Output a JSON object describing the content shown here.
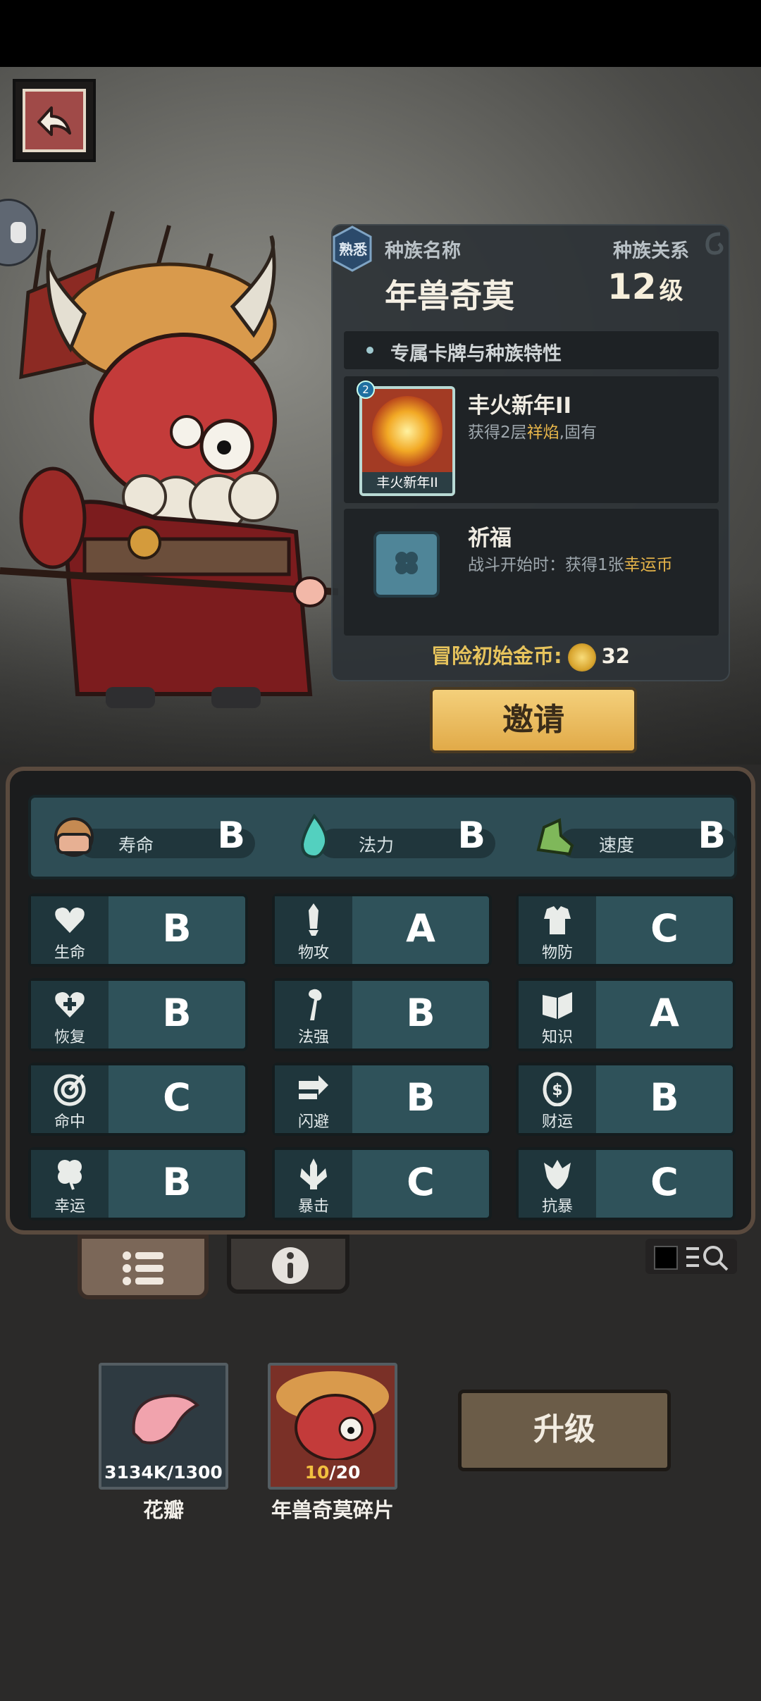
{
  "race": {
    "familiarity_badge": "熟悉",
    "name_label": "种族名称",
    "relation_label": "种族关系",
    "name": "年兽奇莫",
    "level_value": "12",
    "level_unit": "级",
    "section_title": "专属卡牌与种族特性",
    "card": {
      "title": "丰火新年II",
      "desc_prefix": "获得2层",
      "desc_keyword": "祥焰",
      "desc_suffix": ",固有",
      "art_name": "丰火新年II",
      "card_level": "2"
    },
    "trait": {
      "title": "祈福",
      "desc_prefix": "战斗开始时：获得1张",
      "desc_keyword": "幸运币"
    },
    "gold_label": "冒险初始金币:",
    "gold_value": "32"
  },
  "invite_label": "邀请",
  "primary_stats": [
    {
      "name": "寿命",
      "grade": "B",
      "icon": "helmet-icon"
    },
    {
      "name": "法力",
      "grade": "B",
      "icon": "flame-icon"
    },
    {
      "name": "速度",
      "grade": "B",
      "icon": "boot-icon"
    }
  ],
  "stats": [
    {
      "name": "生命",
      "grade": "B",
      "icon": "heart-icon"
    },
    {
      "name": "物攻",
      "grade": "A",
      "icon": "sword-icon"
    },
    {
      "name": "物防",
      "grade": "C",
      "icon": "armor-icon"
    },
    {
      "name": "恢复",
      "grade": "B",
      "icon": "heart-plus-icon"
    },
    {
      "name": "法强",
      "grade": "B",
      "icon": "staff-icon"
    },
    {
      "name": "知识",
      "grade": "A",
      "icon": "book-icon"
    },
    {
      "name": "命中",
      "grade": "C",
      "icon": "target-icon"
    },
    {
      "name": "闪避",
      "grade": "B",
      "icon": "dodge-arrow-icon"
    },
    {
      "name": "财运",
      "grade": "B",
      "icon": "coin-icon"
    },
    {
      "name": "幸运",
      "grade": "B",
      "icon": "clover-icon"
    },
    {
      "name": "暴击",
      "grade": "C",
      "icon": "crit-icon"
    },
    {
      "name": "抗暴",
      "grade": "C",
      "icon": "shield-flower-icon"
    }
  ],
  "items": [
    {
      "name": "花瓣",
      "qty_have": "3134K",
      "qty_sep": "/",
      "qty_need": "1300"
    },
    {
      "name": "年兽奇莫碎片",
      "qty_have": "10",
      "qty_sep": "/",
      "qty_need": "20"
    }
  ],
  "upgrade_label": "升级",
  "colors": {
    "accent_gold": "#e8b64a",
    "board_teal": "#2f525a",
    "invite_btn": "#e1aa48"
  }
}
